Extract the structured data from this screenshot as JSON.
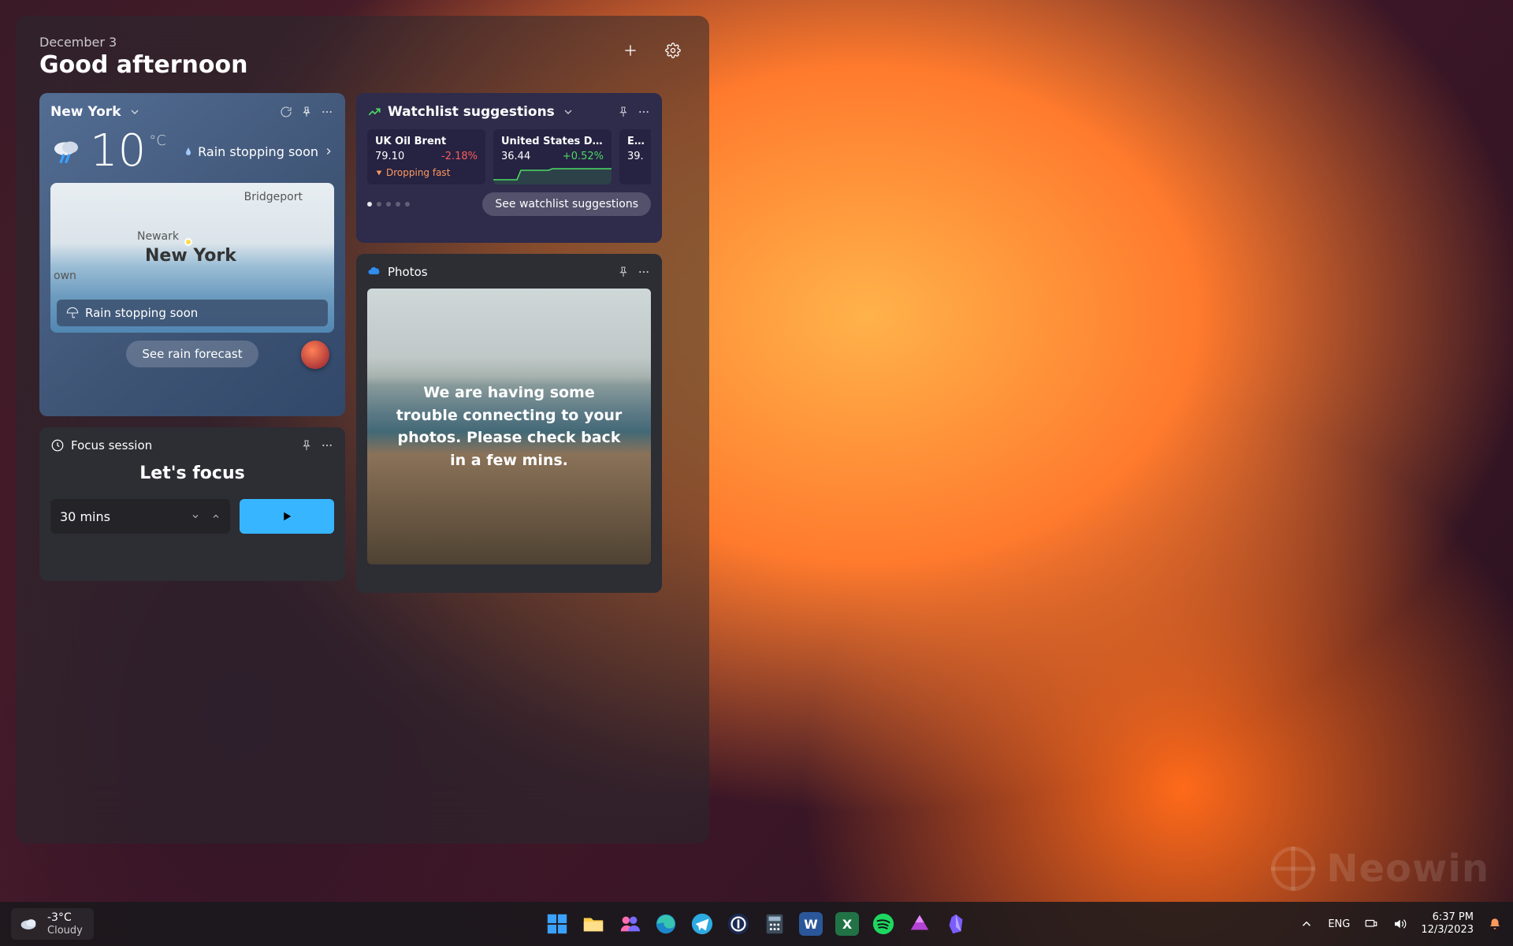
{
  "panel": {
    "date": "December 3",
    "greeting": "Good afternoon"
  },
  "weather": {
    "location": "New York",
    "temp": "10",
    "unit": "°C",
    "status": "Rain stopping soon",
    "map_labels": {
      "bridgeport": "Bridgeport",
      "newark": "Newark",
      "newyork": "New York",
      "own": "own"
    },
    "banner": "Rain stopping soon",
    "forecast_btn": "See rain forecast"
  },
  "focus": {
    "title_label": "Focus session",
    "headline": "Let's focus",
    "duration": "30 mins"
  },
  "watchlist": {
    "title": "Watchlist suggestions",
    "see_more": "See watchlist suggestions",
    "stocks": [
      {
        "name": "UK Oil Brent",
        "price": "79.10",
        "change": "-2.18%",
        "dir": "neg",
        "tag": "Dropping fast"
      },
      {
        "name": "United States D…",
        "price": "36.44",
        "change": "+0.52%",
        "dir": "pos",
        "tag": ""
      },
      {
        "name": "Eu…",
        "price": "39.",
        "change": "",
        "dir": "",
        "tag": ""
      }
    ]
  },
  "photos": {
    "title": "Photos",
    "message": "We are having some trouble connecting to your photos. Please check back in a few mins."
  },
  "taskbar": {
    "weather_temp": "-3°C",
    "weather_cond": "Cloudy",
    "lang": "ENG",
    "time": "6:37 PM",
    "date": "12/3/2023"
  },
  "watermark": "Neowin"
}
